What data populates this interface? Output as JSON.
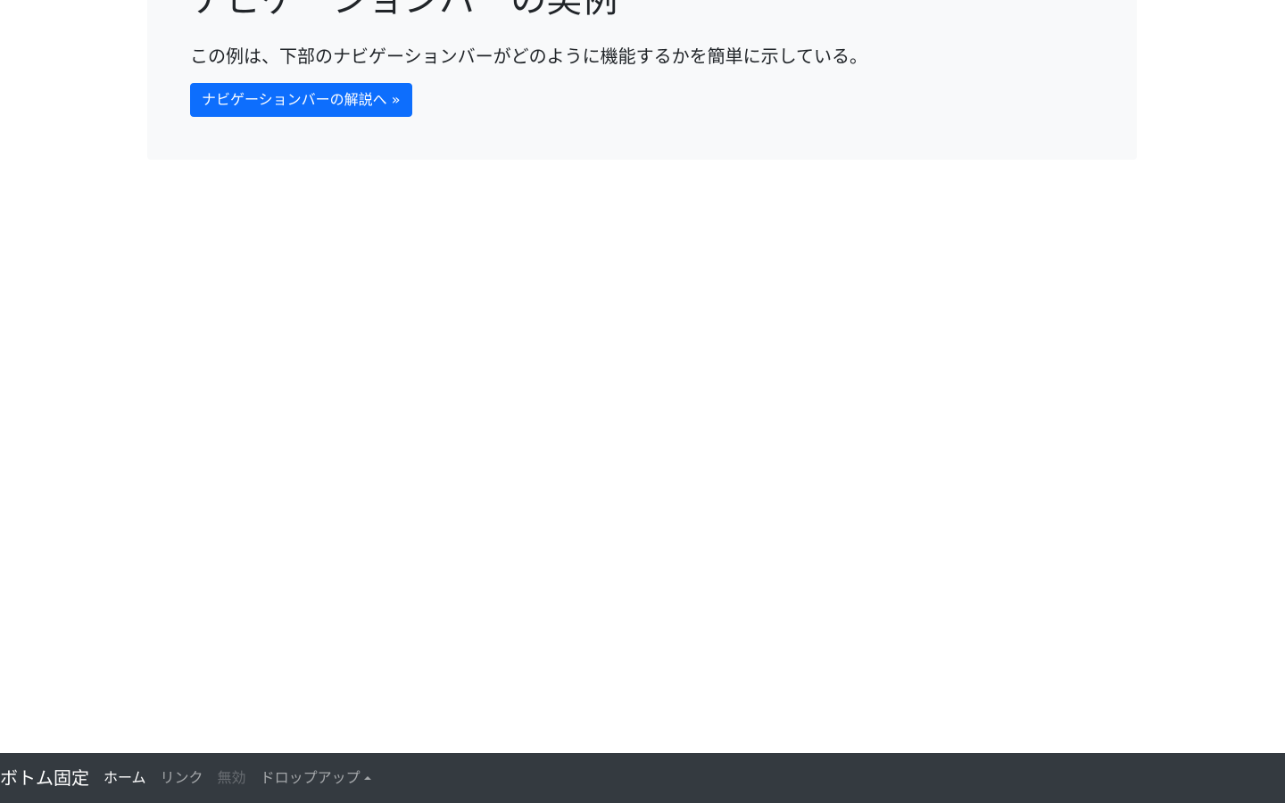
{
  "jumbotron": {
    "title": "ナビゲーションバーの実例",
    "lead": "この例は、下部のナビゲーションバーがどのように機能するかを簡単に示している。",
    "button_label": "ナビゲーションバーの解説へ »"
  },
  "navbar": {
    "brand": "ボトム固定",
    "items": [
      {
        "label": "ホーム",
        "state": "active"
      },
      {
        "label": "リンク",
        "state": "normal"
      },
      {
        "label": "無効",
        "state": "disabled"
      },
      {
        "label": "ドロップアップ",
        "state": "dropdown",
        "icon": "caret-up-icon"
      }
    ]
  },
  "colors": {
    "primary": "#0d6efd",
    "navbar_bg": "#343a40",
    "jumbotron_bg": "#f8f9fa"
  }
}
